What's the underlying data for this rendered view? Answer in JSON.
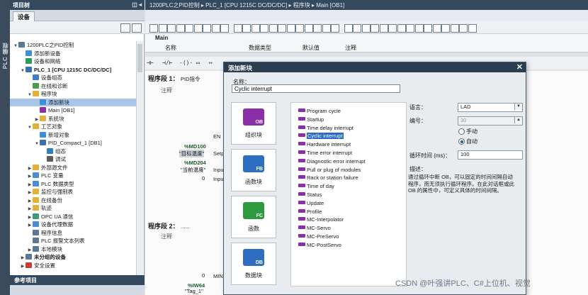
{
  "portal_label": "PLC 编程",
  "project_tree": {
    "title": "项目树",
    "tab": "设备",
    "rows": [
      {
        "label": "1200PLC之PID控制",
        "indent": 0,
        "arrow": "▼",
        "color": "#5a7896"
      },
      {
        "label": "添加新设备",
        "indent": 1,
        "arrow": "",
        "color": "#3e8ed8"
      },
      {
        "label": "设备和网络",
        "indent": 1,
        "arrow": "",
        "color": "#2e9a5a"
      },
      {
        "label": "PLC_1 [CPU 1215C DC/DC/DC]",
        "indent": 1,
        "arrow": "▼",
        "color": "#3a6fb0",
        "bold": true
      },
      {
        "label": "设备组态",
        "indent": 2,
        "arrow": "",
        "color": "#3a7fc8"
      },
      {
        "label": "在线和诊断",
        "indent": 2,
        "arrow": "",
        "color": "#4b9b4b"
      },
      {
        "label": "程序块",
        "indent": 2,
        "arrow": "▼",
        "color": "#e3b13a"
      },
      {
        "label": "添加新块",
        "indent": 3,
        "arrow": "",
        "color": "#3e8ed8",
        "selected": true
      },
      {
        "label": "Main [OB1]",
        "indent": 3,
        "arrow": "",
        "color": "#8a2fa8"
      },
      {
        "label": "系统块",
        "indent": 3,
        "arrow": "▶",
        "color": "#e3b13a"
      },
      {
        "label": "工艺对象",
        "indent": 2,
        "arrow": "▼",
        "color": "#e3b13a"
      },
      {
        "label": "新增对象",
        "indent": 3,
        "arrow": "",
        "color": "#3e8ed8"
      },
      {
        "label": "PID_Compact_1 [DB1]",
        "indent": 3,
        "arrow": "▼",
        "color": "#3a6fb0"
      },
      {
        "label": "组态",
        "indent": 4,
        "arrow": "",
        "color": "#2f7fc0"
      },
      {
        "label": "调试",
        "indent": 4,
        "arrow": "",
        "color": "#5c5c5c"
      },
      {
        "label": "外部源文件",
        "indent": 2,
        "arrow": "▶",
        "color": "#e3b13a"
      },
      {
        "label": "PLC 变量",
        "indent": 2,
        "arrow": "▶",
        "color": "#4a8ed0"
      },
      {
        "label": "PLC 数据类型",
        "indent": 2,
        "arrow": "▶",
        "color": "#4a8ed0"
      },
      {
        "label": "监控与强制表",
        "indent": 2,
        "arrow": "▶",
        "color": "#e3b13a"
      },
      {
        "label": "在线备份",
        "indent": 2,
        "arrow": "▶",
        "color": "#e3b13a"
      },
      {
        "label": "轨迹",
        "indent": 2,
        "arrow": "▶",
        "color": "#e3b13a"
      },
      {
        "label": "OPC UA 通信",
        "indent": 2,
        "arrow": "▶",
        "color": "#3a9a7a"
      },
      {
        "label": "设备代理数据",
        "indent": 2,
        "arrow": "▶",
        "color": "#4a8ed0"
      },
      {
        "label": "程序信息",
        "indent": 2,
        "arrow": "",
        "color": "#5a7896"
      },
      {
        "label": "PLC 报警文本列表",
        "indent": 2,
        "arrow": "",
        "color": "#5a7896"
      },
      {
        "label": "本地模块",
        "indent": 2,
        "arrow": "▶",
        "color": "#5a7896"
      },
      {
        "label": "未分组的设备",
        "indent": 1,
        "arrow": "▶",
        "color": "#5a7896",
        "bold": true
      },
      {
        "label": "安全设置",
        "indent": 1,
        "arrow": "▶",
        "color": "#c04040"
      }
    ],
    "reference_projects": "参考项目"
  },
  "editor": {
    "breadcrumb": "1200PLC之PID控制 ▸ PLC_1 [CPU 1215C DC/DC/DC] ▸ 程序块 ▸ Main [OB1]",
    "block_name": "Main",
    "columns": [
      "名称",
      "数据类型",
      "默认值",
      "注释"
    ],
    "network1_title": "程序段 1：",
    "network1_sub": "PID指令",
    "comment_label": "注释",
    "network2_title": "程序段 2：",
    "network2_sub": "......",
    "en_label": "EN",
    "setpoint_pin": "Setp",
    "input_pin": "Inpu",
    "input_pin2": "Inpu",
    "min_pin": "MIN",
    "tag1_addr": "%MD100",
    "tag1_name": "\"目标温度\"",
    "tag2_addr": "%MD204",
    "tag2_name": "\"当前温度\"",
    "tag3_zero": "0",
    "tag4_zero": "0",
    "tag5_addr": "%IW64",
    "tag5_name": "\"Tag_1\""
  },
  "dialog": {
    "title": "添加新块",
    "name_label": "名称：",
    "name_value": "Cyclic interrupt",
    "cards": [
      {
        "label": "组织块",
        "tag": "OB",
        "color": "#8a2fa8"
      },
      {
        "label": "函数块",
        "tag": "FB",
        "color": "#2f6fc2"
      },
      {
        "label": "函数",
        "tag": "FC",
        "color": "#2e9a3e"
      },
      {
        "label": "数据块",
        "tag": "DB",
        "color": "#2f6fc2"
      }
    ],
    "ob_types": [
      "Program cycle",
      "Startup",
      "Time delay interrupt",
      "Cyclic interrupt",
      "Hardware interrupt",
      "Time error interrupt",
      "Diagnostic error interrupt",
      "Pull or plug of modules",
      "Rack or station failure",
      "Time of day",
      "Status",
      "Update",
      "Profile",
      "MC-Interpolator",
      "MC-Servo",
      "MC-PreServo",
      "MC-PostServo"
    ],
    "selected_ob": "Cyclic interrupt",
    "language_label": "语言：",
    "language_value": "LAD",
    "number_label": "编号：",
    "number_value": "30",
    "manual_label": "手动",
    "auto_label": "自动",
    "cycle_label": "循环时间 (ms)：",
    "cycle_value": "100",
    "desc_label": "描述：",
    "desc_text": "通过循环中断 OB，可以固定的时间间隔自动程序，而无须执行循环程序。在此对话框或此 OB 的属性中，可定义具体的时间间隔。"
  },
  "watermark": "CSDN @叶强讲PLC、C#上位机、视觉"
}
